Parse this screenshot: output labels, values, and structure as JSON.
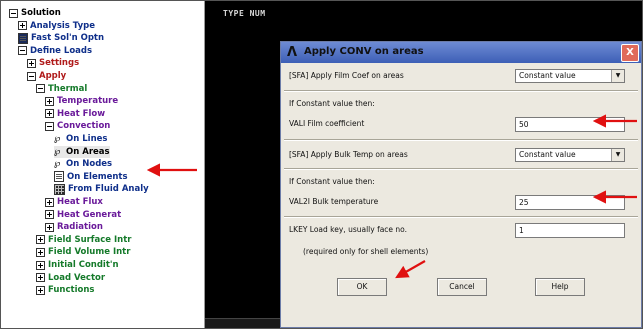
{
  "tree": {
    "items": [
      {
        "label": "Solution",
        "level": 0,
        "icon": "minus-box-icon",
        "color": "black"
      },
      {
        "label": "Analysis Type",
        "level": 1,
        "icon": "plus-box-icon",
        "color": "blue"
      },
      {
        "label": "Fast Sol'n Optn",
        "level": 1,
        "icon": "document-icon",
        "color": "blue"
      },
      {
        "label": "Define Loads",
        "level": 1,
        "icon": "minus-box-icon",
        "color": "blue"
      },
      {
        "label": "Settings",
        "level": 2,
        "icon": "plus-box-icon",
        "color": "red"
      },
      {
        "label": "Apply",
        "level": 2,
        "icon": "minus-box-icon",
        "color": "red"
      },
      {
        "label": "Thermal",
        "level": 3,
        "icon": "minus-box-icon",
        "color": "green"
      },
      {
        "label": "Temperature",
        "level": 4,
        "icon": "plus-box-icon",
        "color": "purple"
      },
      {
        "label": "Heat Flow",
        "level": 4,
        "icon": "plus-box-icon",
        "color": "purple"
      },
      {
        "label": "Convection",
        "level": 4,
        "icon": "minus-box-icon",
        "color": "purple"
      },
      {
        "label": "On Lines",
        "level": 5,
        "icon": "function-icon",
        "color": "blue"
      },
      {
        "label": "On Areas",
        "level": 5,
        "icon": "function-icon",
        "color": "black",
        "selected": true
      },
      {
        "label": "On Nodes",
        "level": 5,
        "icon": "function-icon",
        "color": "blue"
      },
      {
        "label": "On Elements",
        "level": 5,
        "icon": "document-icon",
        "color": "blue"
      },
      {
        "label": "From Fluid Analy",
        "level": 5,
        "icon": "grid-icon",
        "color": "blue"
      },
      {
        "label": "Heat Flux",
        "level": 4,
        "icon": "plus-box-icon",
        "color": "purple"
      },
      {
        "label": "Heat Generat",
        "level": 4,
        "icon": "plus-box-icon",
        "color": "purple"
      },
      {
        "label": "Radiation",
        "level": 4,
        "icon": "plus-box-icon",
        "color": "purple"
      },
      {
        "label": "Field Surface Intr",
        "level": 3,
        "icon": "plus-box-icon",
        "color": "green"
      },
      {
        "label": "Field Volume Intr",
        "level": 3,
        "icon": "plus-box-icon",
        "color": "green"
      },
      {
        "label": "Initial Condit'n",
        "level": 3,
        "icon": "plus-box-icon",
        "color": "green"
      },
      {
        "label": "Load Vector",
        "level": 3,
        "icon": "plus-box-icon",
        "color": "green"
      },
      {
        "label": "Functions",
        "level": 3,
        "icon": "plus-box-icon",
        "color": "green"
      }
    ]
  },
  "graphics": {
    "title": "TYPE NUM"
  },
  "dialog": {
    "logo": "Λ",
    "title": "Apply CONV on areas",
    "close_label": "X",
    "row1_label": "[SFA] Apply Film Coef on areas",
    "row1_value": "Constant value",
    "section1_label": "If Constant value then:",
    "val1_label": "VALI  Film coefficient",
    "val1_value": "50",
    "row2_label": "[SFA] Apply Bulk Temp on areas",
    "row2_value": "Constant value",
    "section2_label": "If Constant value then:",
    "val2_label": "VAL2I  Bulk temperature",
    "val2_value": "25",
    "lkey_label": "LKEY  Load key, usually face no.",
    "lkey_value": "1",
    "lkey_note": "(required only for shell elements)",
    "ok_label": "OK",
    "cancel_label": "Cancel",
    "help_label": "Help",
    "dropdown_arrow": "▼"
  },
  "colors": {
    "annotation_arrow": "#e01010",
    "titlebar": "#4a6cc4"
  }
}
